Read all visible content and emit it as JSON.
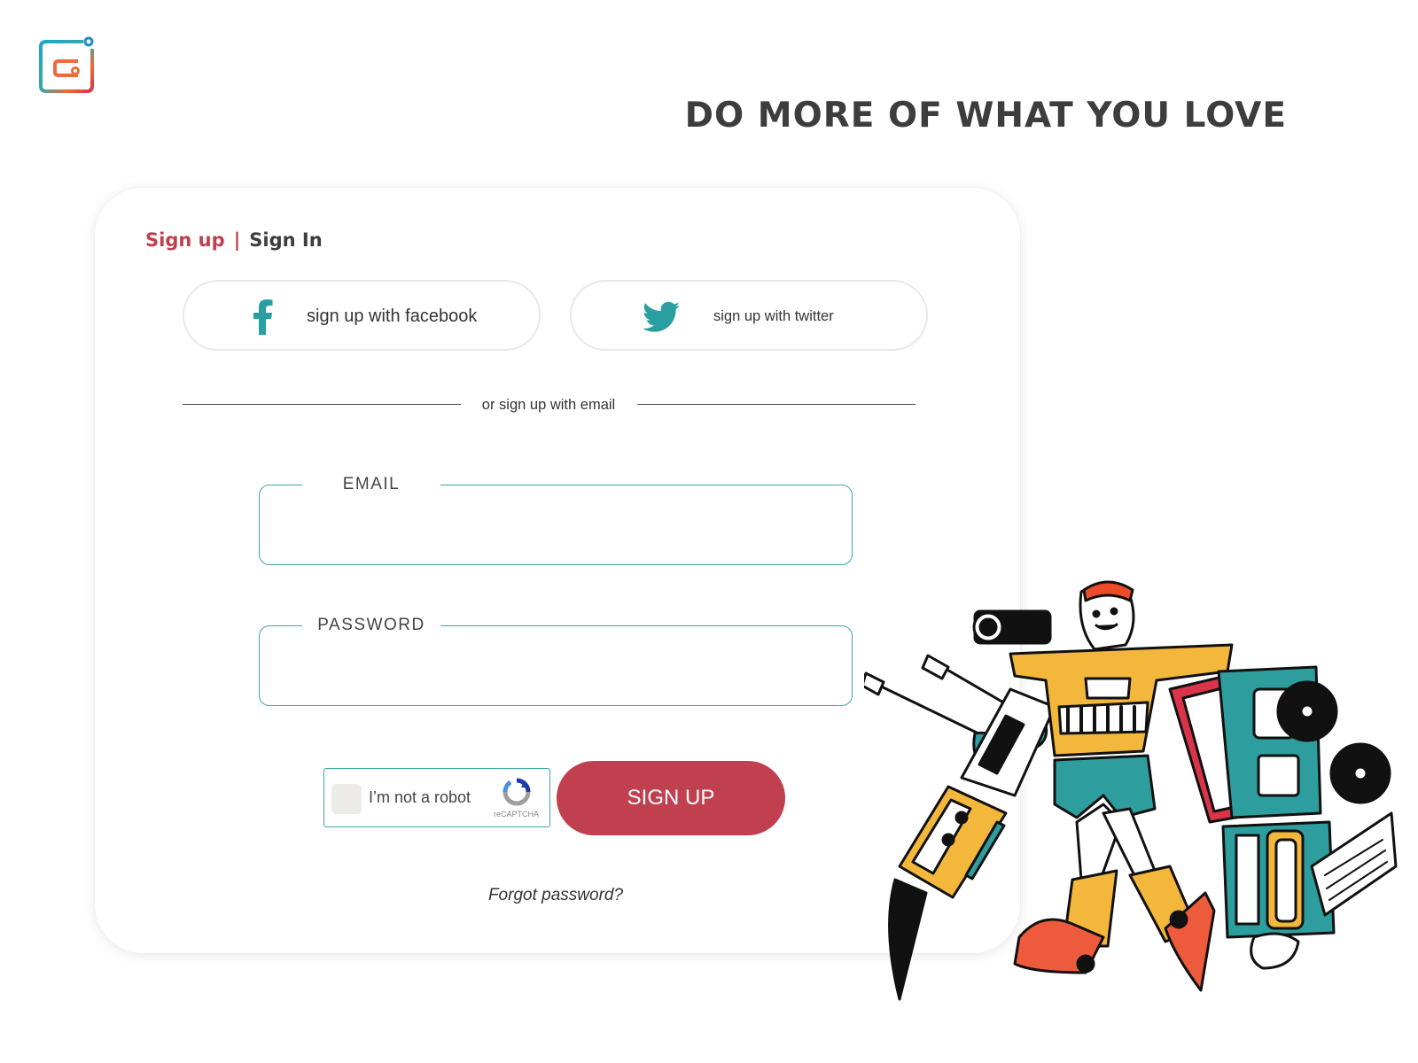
{
  "brand": {
    "logo_icon": "app-logo-icon"
  },
  "headline": "DO MORE OF WHAT YOU LOVE",
  "tabs": {
    "signup": "Sign up",
    "separator": "|",
    "signin": "Sign In"
  },
  "social": {
    "facebook": {
      "label": "sign up with facebook",
      "icon": "facebook-icon"
    },
    "twitter": {
      "label": "sign up with twitter",
      "icon": "twitter-icon"
    }
  },
  "divider": "or sign up with email",
  "form": {
    "email": {
      "label": "EMAIL",
      "value": ""
    },
    "password": {
      "label": "PASSWORD",
      "value": ""
    }
  },
  "captcha": {
    "label": "I’m not a robot",
    "brand": "reCAPTCHA",
    "checked": false
  },
  "submit": "SIGN UP",
  "forgot": "Forgot password?",
  "colors": {
    "accent": "#c0404f",
    "teal": "#3ba7a3",
    "yellow": "#f3b73c",
    "orange": "#ee5b3c"
  }
}
